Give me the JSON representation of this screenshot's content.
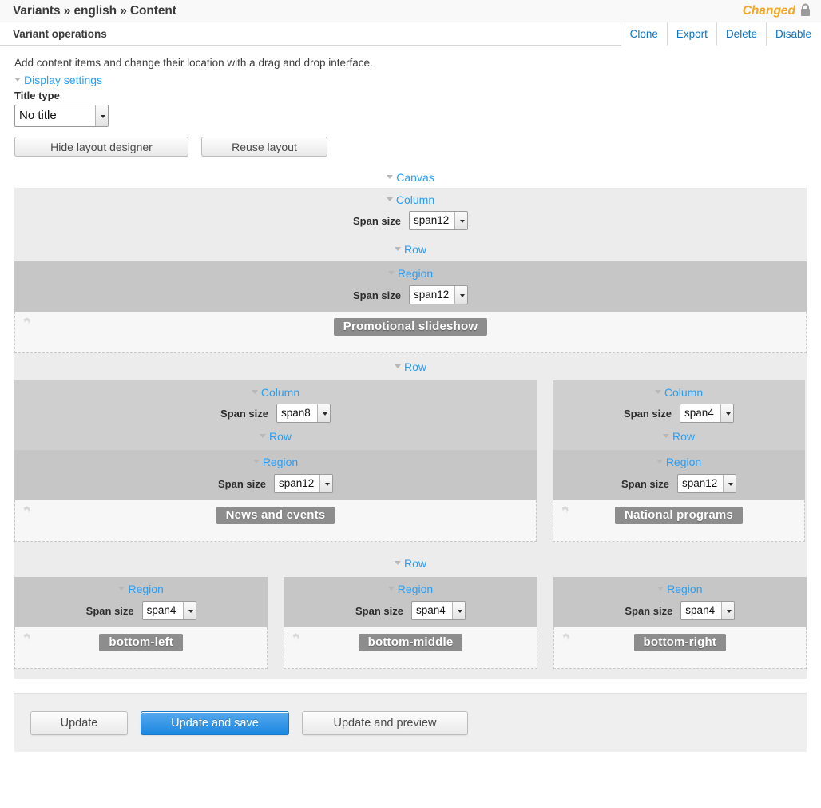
{
  "header": {
    "breadcrumb": "Variants » english » Content",
    "status_label": "Changed",
    "lock_icon": "lock-icon",
    "accent_orange": "#f5a623",
    "link_blue": "#2a9ef4",
    "action_blue": "#0b72c4"
  },
  "operations": {
    "title": "Variant operations",
    "actions": [
      {
        "label": "Clone"
      },
      {
        "label": "Export"
      },
      {
        "label": "Delete"
      },
      {
        "label": "Disable"
      }
    ]
  },
  "intro": {
    "description": "Add content items and change their location with a drag and drop interface."
  },
  "display_settings": {
    "disclosure_label": "Display settings",
    "title_type_label": "Title type",
    "title_type_value": "No title",
    "title_type_options": [
      "No title"
    ]
  },
  "designer_buttons": {
    "hide_layout": "Hide layout designer",
    "reuse_layout": "Reuse layout"
  },
  "layout": {
    "canvas_label": "Canvas",
    "column_label": "Column",
    "row_label": "Row",
    "region_label": "Region",
    "span_size_label": "Span size",
    "span_options": [
      "span4",
      "span8",
      "span12"
    ],
    "top_column_span": "span12",
    "top_region_span": "span12",
    "top_block": "Promotional slideshow",
    "mid_left": {
      "column_span": "span8",
      "region_span": "span12",
      "block": "News and events"
    },
    "mid_right": {
      "column_span": "span4",
      "region_span": "span12",
      "block": "National programs"
    },
    "bottom": [
      {
        "span": "span4",
        "block": "bottom-left"
      },
      {
        "span": "span4",
        "block": "bottom-middle"
      },
      {
        "span": "span4",
        "block": "bottom-right"
      }
    ]
  },
  "footer": {
    "update": "Update",
    "update_and_save": "Update and save",
    "update_and_preview": "Update and preview",
    "primary_color": "#1b87e0"
  }
}
